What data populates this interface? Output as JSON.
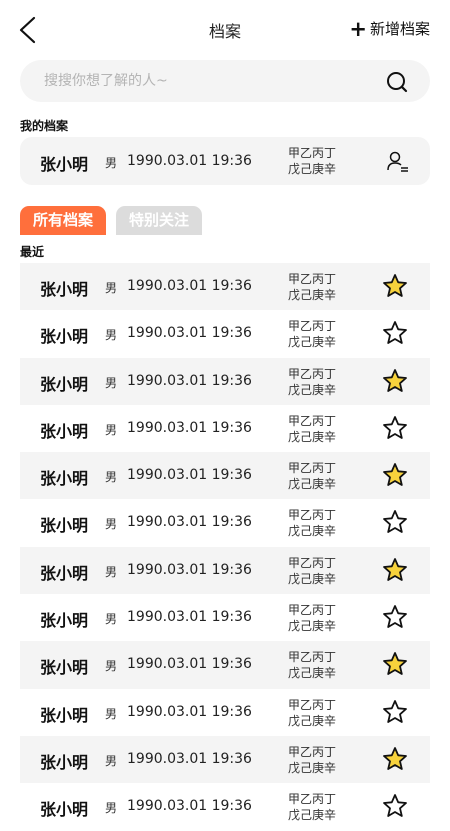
{
  "nav": {
    "title": "档案",
    "add_label": "新增档案"
  },
  "search": {
    "placeholder": "搜搜你想了解的人~"
  },
  "my_section": {
    "label": "我的档案",
    "profile": {
      "name": "张小明",
      "gender": "男",
      "birth": "1990.03.01 19:36",
      "gz1": "甲乙丙丁",
      "gz2": "戊己庚辛"
    }
  },
  "tabs": [
    {
      "label": "所有档案",
      "active": true
    },
    {
      "label": "特别关注",
      "active": false
    }
  ],
  "recent_label": "最近",
  "colors": {
    "accent": "#ff6f3c",
    "star_fill": "#f7d23c",
    "card_bg": "#f4f4f4",
    "inactive_tab": "#dcdcdc"
  },
  "records": [
    {
      "name": "张小明",
      "gender": "男",
      "birth": "1990.03.01 19:36",
      "gz1": "甲乙丙丁",
      "gz2": "戊己庚辛",
      "starred": true
    },
    {
      "name": "张小明",
      "gender": "男",
      "birth": "1990.03.01 19:36",
      "gz1": "甲乙丙丁",
      "gz2": "戊己庚辛",
      "starred": false
    },
    {
      "name": "张小明",
      "gender": "男",
      "birth": "1990.03.01 19:36",
      "gz1": "甲乙丙丁",
      "gz2": "戊己庚辛",
      "starred": true
    },
    {
      "name": "张小明",
      "gender": "男",
      "birth": "1990.03.01 19:36",
      "gz1": "甲乙丙丁",
      "gz2": "戊己庚辛",
      "starred": false
    },
    {
      "name": "张小明",
      "gender": "男",
      "birth": "1990.03.01 19:36",
      "gz1": "甲乙丙丁",
      "gz2": "戊己庚辛",
      "starred": true
    },
    {
      "name": "张小明",
      "gender": "男",
      "birth": "1990.03.01 19:36",
      "gz1": "甲乙丙丁",
      "gz2": "戊己庚辛",
      "starred": false
    },
    {
      "name": "张小明",
      "gender": "男",
      "birth": "1990.03.01 19:36",
      "gz1": "甲乙丙丁",
      "gz2": "戊己庚辛",
      "starred": true
    },
    {
      "name": "张小明",
      "gender": "男",
      "birth": "1990.03.01 19:36",
      "gz1": "甲乙丙丁",
      "gz2": "戊己庚辛",
      "starred": false
    },
    {
      "name": "张小明",
      "gender": "男",
      "birth": "1990.03.01 19:36",
      "gz1": "甲乙丙丁",
      "gz2": "戊己庚辛",
      "starred": true
    },
    {
      "name": "张小明",
      "gender": "男",
      "birth": "1990.03.01 19:36",
      "gz1": "甲乙丙丁",
      "gz2": "戊己庚辛",
      "starred": false
    },
    {
      "name": "张小明",
      "gender": "男",
      "birth": "1990.03.01 19:36",
      "gz1": "甲乙丙丁",
      "gz2": "戊己庚辛",
      "starred": true
    },
    {
      "name": "张小明",
      "gender": "男",
      "birth": "1990.03.01 19:36",
      "gz1": "甲乙丙丁",
      "gz2": "戊己庚辛",
      "starred": false
    }
  ]
}
